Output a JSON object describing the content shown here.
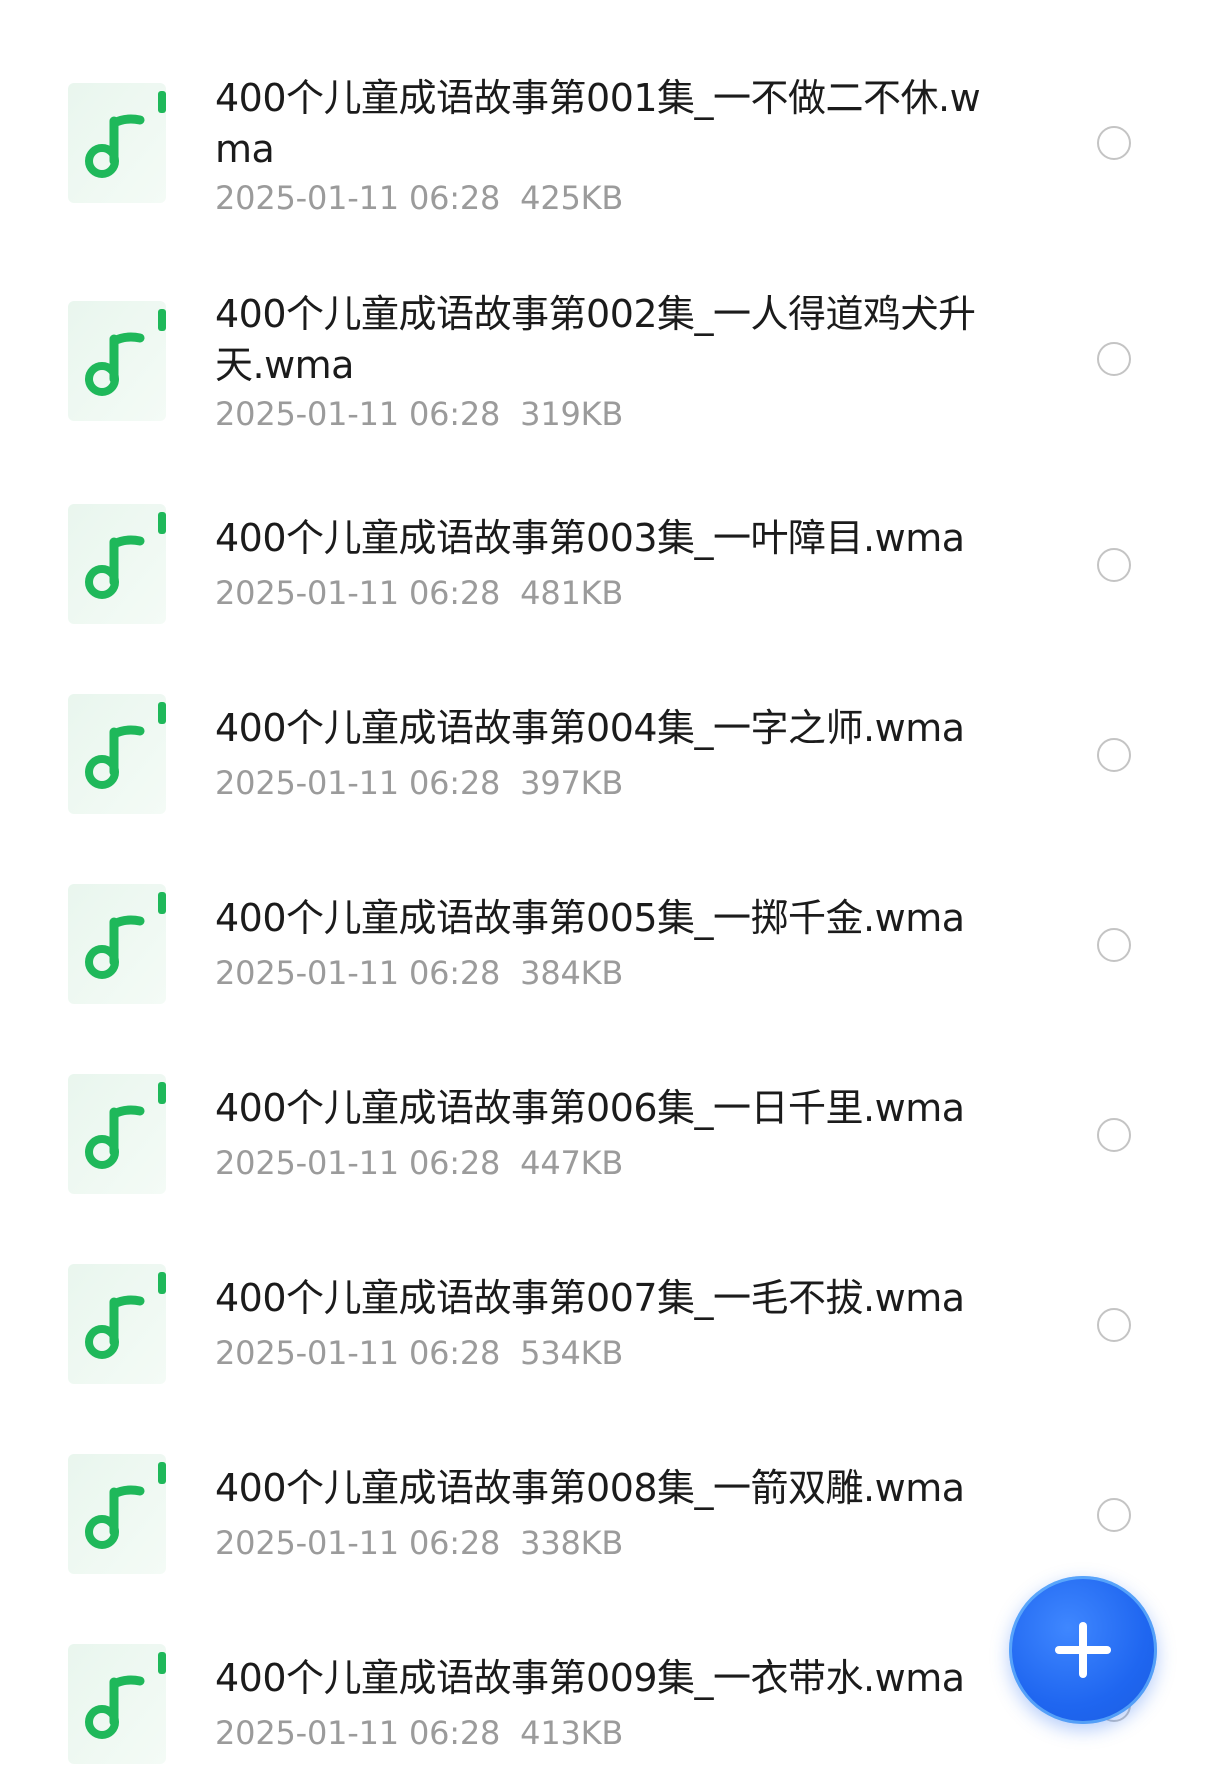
{
  "files": [
    {
      "name": "400个儿童成语故事第001集_一不做二不休.wma",
      "date": "2025-01-11 06:28",
      "size": "425KB",
      "selected": false
    },
    {
      "name": "400个儿童成语故事第002集_一人得道鸡犬升天.wma",
      "date": "2025-01-11 06:28",
      "size": "319KB",
      "selected": false
    },
    {
      "name": "400个儿童成语故事第003集_一叶障目.wma",
      "date": "2025-01-11 06:28",
      "size": "481KB",
      "selected": false
    },
    {
      "name": "400个儿童成语故事第004集_一字之师.wma",
      "date": "2025-01-11 06:28",
      "size": "397KB",
      "selected": false
    },
    {
      "name": "400个儿童成语故事第005集_一掷千金.wma",
      "date": "2025-01-11 06:28",
      "size": "384KB",
      "selected": false
    },
    {
      "name": "400个儿童成语故事第006集_一日千里.wma",
      "date": "2025-01-11 06:28",
      "size": "447KB",
      "selected": false
    },
    {
      "name": "400个儿童成语故事第007集_一毛不拔.wma",
      "date": "2025-01-11 06:28",
      "size": "534KB",
      "selected": false
    },
    {
      "name": "400个儿童成语故事第008集_一箭双雕.wma",
      "date": "2025-01-11 06:28",
      "size": "338KB",
      "selected": false
    },
    {
      "name": "400个儿童成语故事第009集_一衣带水.wma",
      "date": "2025-01-11 06:28",
      "size": "413KB",
      "selected": false
    }
  ],
  "file_icon": "audio-file-icon",
  "fab": {
    "icon": "plus-icon",
    "color": "#1f66f0"
  },
  "colors": {
    "accent_green": "#1fb85a",
    "icon_bg": "#e9f6ee",
    "meta_text": "#9b9b9b"
  }
}
